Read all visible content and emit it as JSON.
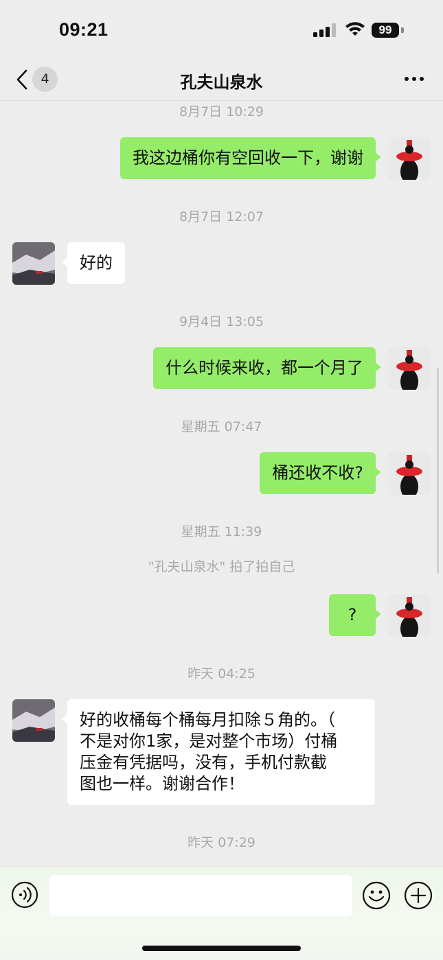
{
  "status": {
    "time": "09:21",
    "battery": "99"
  },
  "nav": {
    "back_count": "4",
    "title": "孔夫山泉水"
  },
  "chat": {
    "ts1": "8月7日 10:29",
    "msg1": "我这边桶你有空回收一下，谢谢",
    "ts2": "8月7日 12:07",
    "msg2": "好的",
    "ts3": "9月4日 13:05",
    "msg3": "什么时候来收，都一个月了",
    "ts4": "星期五 07:47",
    "msg4": "桶还收不收?",
    "ts5": "星期五 11:39",
    "pat": "\"孔夫山泉水\" 拍了拍自己",
    "msg5": "?",
    "ts6": "昨天 04:25",
    "msg6_line1": "好的收桶每个桶每月扣除５角的。（",
    "msg6_line2": "不是对你1家，是对整个市场）付桶",
    "msg6_line3": "压金有凭据吗，没有，手机付款截",
    "msg6_line4": "图也一样。谢谢合作！",
    "ts7": "昨天 07:29"
  },
  "input": {
    "value": ""
  },
  "icons": {
    "back": "chevron-left-icon",
    "more": "more-icon",
    "voice": "voice-icon",
    "emoji": "emoji-icon",
    "plus": "plus-icon"
  },
  "colors": {
    "my_bubble": "#95ec69",
    "their_bubble": "#ffffff",
    "background": "#ededed"
  }
}
